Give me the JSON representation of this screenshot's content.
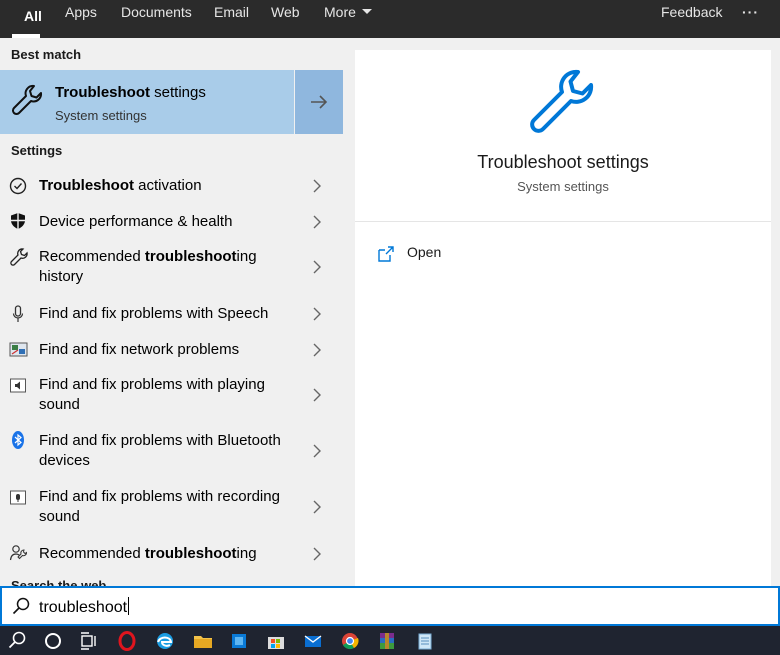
{
  "tabs": [
    "All",
    "Apps",
    "Documents",
    "Email",
    "Web",
    "More"
  ],
  "feedback_label": "Feedback",
  "ellipsis": "···",
  "best_match_heading": "Best match",
  "best_match": {
    "title_bold": "Troubleshoot",
    "title_rest": " settings",
    "subtitle": "System settings"
  },
  "settings_heading": "Settings",
  "settings_items": [
    {
      "bold": "Troubleshoot",
      "rest": " activation",
      "icon": "check-circle-icon"
    },
    {
      "pre": "Device performance & health",
      "icon": "shield-icon"
    },
    {
      "pre": "Recommended ",
      "bold": "troubleshoot",
      "rest": "ing",
      "line2": "history",
      "icon": "wrench-icon"
    },
    {
      "pre": "Find and fix problems with Speech",
      "icon": "microphone-icon"
    },
    {
      "pre": "Find and fix network problems",
      "icon": "network-icon"
    },
    {
      "pre": "Find and fix problems with playing",
      "line2": "sound",
      "icon": "speaker-icon"
    },
    {
      "pre": "Find and fix problems with Bluetooth",
      "line2": "devices",
      "icon": "bluetooth-icon"
    },
    {
      "pre": "Find and fix problems with recording",
      "line2": "sound",
      "icon": "recording-icon"
    },
    {
      "pre": "Recommended ",
      "bold": "troubleshoot",
      "rest": "ing",
      "icon": "person-help-icon"
    }
  ],
  "search_web_heading": "Search the web",
  "preview": {
    "title": "Troubleshoot settings",
    "subtitle": "System settings",
    "action_open": "Open"
  },
  "search": {
    "value": "troubleshoot"
  },
  "colors": {
    "accent": "#0078d7",
    "selected": "#a9cce9"
  },
  "taskbar_icons": [
    "search-icon",
    "cortana-icon",
    "task-view-icon",
    "opera-icon",
    "edge-icon",
    "file-explorer-icon",
    "store-icon",
    "microsoft-store-icon",
    "mail-icon",
    "chrome-icon",
    "winrar-icon",
    "notepad-icon"
  ]
}
